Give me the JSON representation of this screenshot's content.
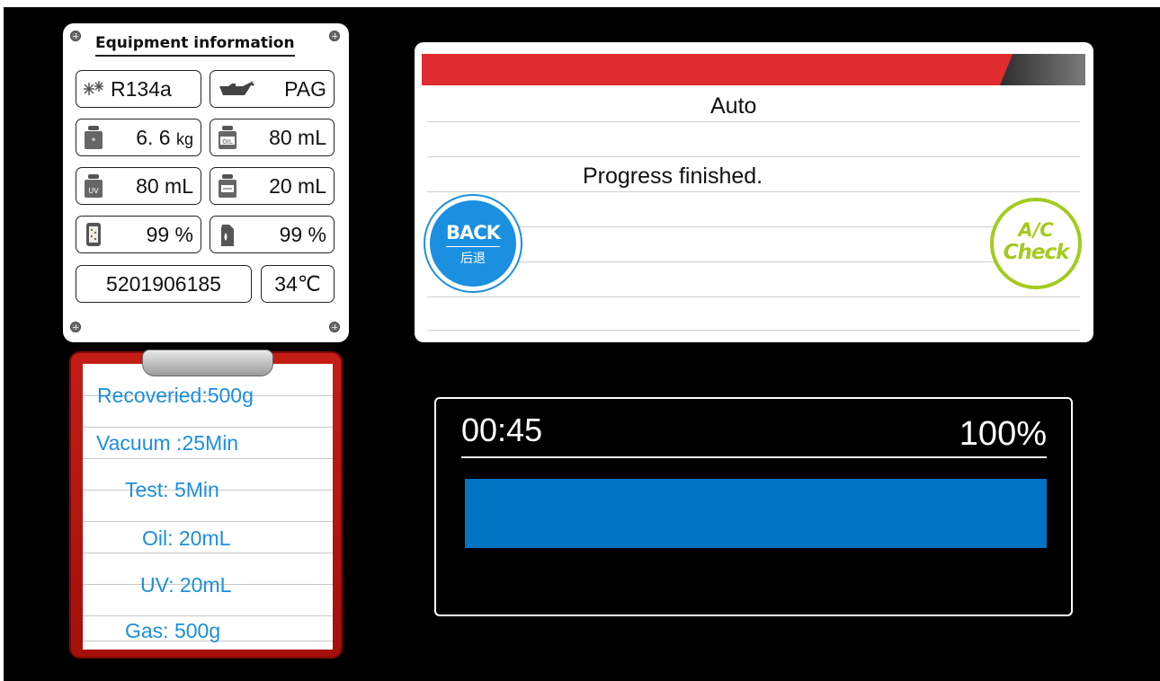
{
  "equipment": {
    "title": "Equipment information",
    "refrigerant": "R134a",
    "oil_type": "PAG",
    "refrigerant_weight": "6. 6",
    "refrigerant_weight_unit": "kg",
    "oil_amount": "80 mL",
    "uv_amount": "80 mL",
    "dye_amount": "20 mL",
    "filter_level": "99 %",
    "oil_level": "99 %",
    "serial_number": "5201906185",
    "temperature": "34℃"
  },
  "summary": {
    "recovered": "Recoveried:500g",
    "vacuum": "Vacuum :25Min",
    "test": "Test:  5Min",
    "oil": "Oil:  20mL",
    "uv": "UV:  20mL",
    "gas": "Gas:  500g"
  },
  "dialog": {
    "mode": "Auto",
    "message": "Progress finished.",
    "back_label": "BACK",
    "back_label_cn": "后退",
    "ac_label_1": "A/C",
    "ac_label_2": "Check"
  },
  "progress": {
    "time": "00:45",
    "percent_label": "100%",
    "percent": 100
  },
  "colors": {
    "accent_blue": "#0074c2",
    "header_red": "#e02b2f",
    "ac_green": "#a3cb1d",
    "clipboard_red": "#c41d16"
  }
}
